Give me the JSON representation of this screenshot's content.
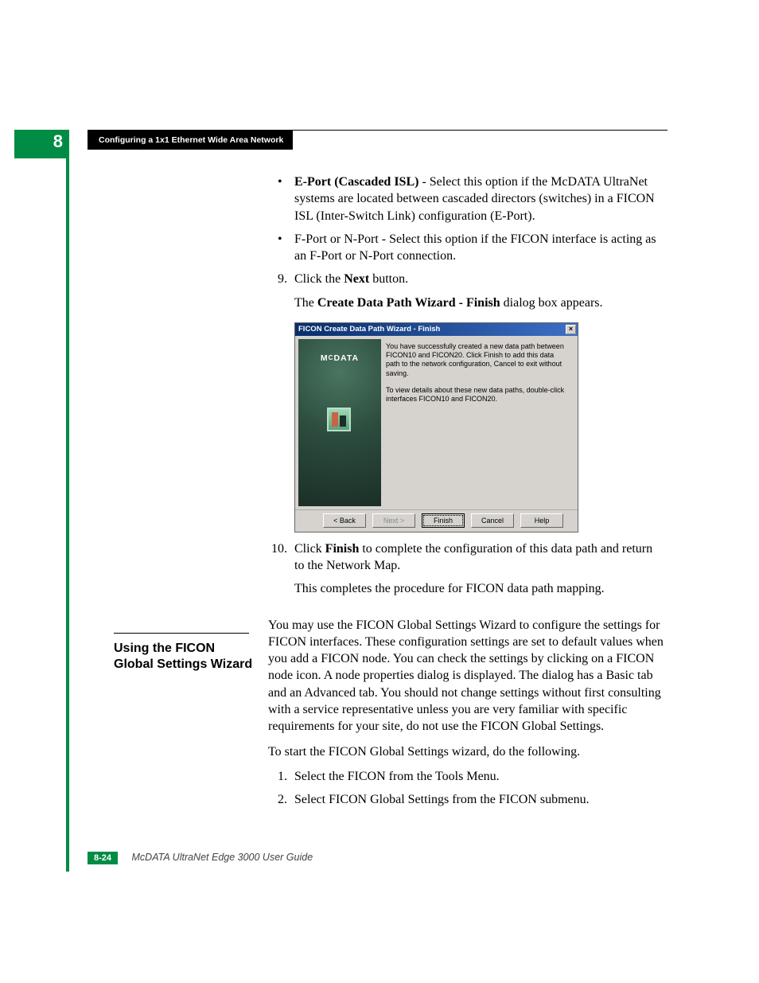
{
  "chapter": {
    "number": "8",
    "title": "Configuring a 1x1 Ethernet Wide Area Network"
  },
  "body": {
    "bullet_a": {
      "bold": "E-Port (Cascaded ISL)",
      "rest": " - Select this option if the McDATA UltraNet systems are located between cascaded directors (switches) in a FICON ISL (Inter-Switch Link) configuration (E-Port)."
    },
    "bullet_b": "F-Port or N-Port - Select this option if the FICON interface is acting as an F-Port or N-Port connection.",
    "step9": {
      "num": "9.",
      "pre": "Click the ",
      "bold": "Next",
      "post": " button.",
      "follow_pre": "The ",
      "follow_bold": "Create Data Path Wizard - Finish",
      "follow_post": " dialog box appears."
    },
    "step10": {
      "num": "10.",
      "pre": "Click ",
      "bold": "Finish",
      "post": " to complete the configuration of this data path and return to the Network Map."
    },
    "complete": "This completes the procedure for FICON data path mapping."
  },
  "dialog": {
    "title": "FICON Create Data Path Wizard - Finish",
    "logo": "MCDATA",
    "msg1": "You have successfully created a new data path between FICON10 and FICON20.  Click Finish to add this data path to the network configuration, Cancel to exit without saving.",
    "msg2": "To view details about these new data paths, double-click interfaces FICON10 and FICON20.",
    "buttons": {
      "back": "< Back",
      "next": "Next >",
      "finish": "Finish",
      "cancel": "Cancel",
      "help": "Help"
    }
  },
  "section": {
    "heading": "Using the FICON Global Settings Wizard",
    "para1": "You may use the FICON Global Settings Wizard to configure the settings for FICON interfaces. These configuration settings are set to default values when you add a FICON node. You can check the settings by clicking on a FICON node icon. A node properties dialog is displayed. The dialog has a Basic tab and an Advanced tab. You should not change settings without first consulting with a service representative unless you are very familiar with specific requirements for your site, do not use the FICON Global Settings.",
    "para2": "To start the FICON Global Settings wizard, do the following.",
    "step1": {
      "num": "1.",
      "text": "Select the FICON from the Tools Menu."
    },
    "step2": {
      "num": "2.",
      "text": "Select FICON Global Settings from the FICON submenu."
    }
  },
  "footer": {
    "page": "8-24",
    "doc": "McDATA UltraNet Edge 3000 User Guide"
  }
}
